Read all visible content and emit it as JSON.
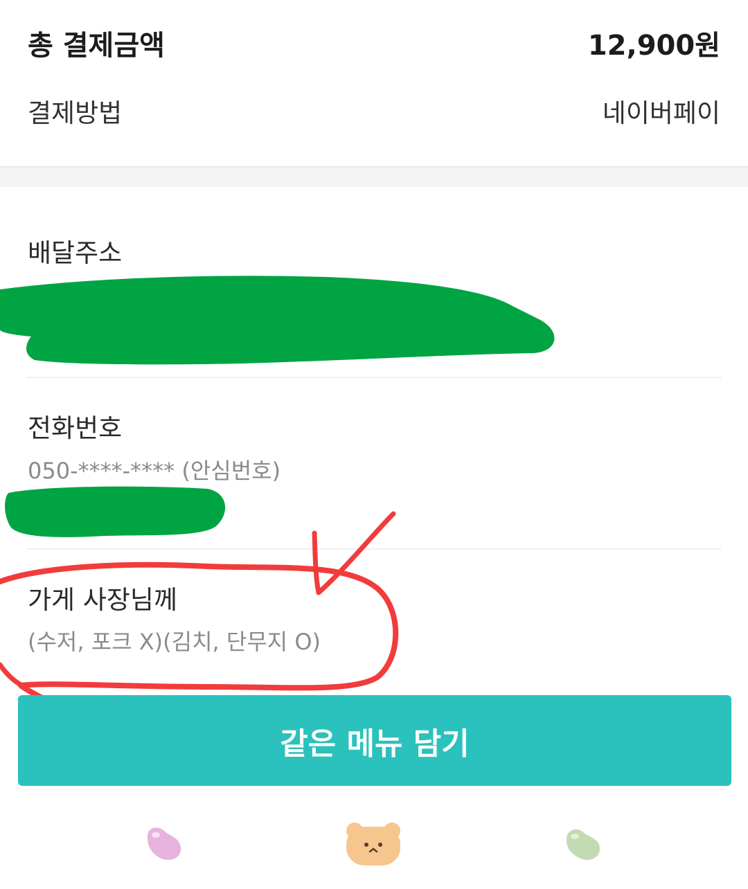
{
  "payment": {
    "total_label": "총 결제금액",
    "total_value": "12,900원",
    "method_label": "결제방법",
    "method_value": "네이버페이"
  },
  "delivery": {
    "address_label": "배달주소"
  },
  "phone": {
    "label": "전화번호",
    "value": "050-****-**** (안심번호)"
  },
  "owner_note": {
    "label": "가게 사장님께",
    "value": "(수저, 포크 X)(김치, 단무지 O)"
  },
  "actions": {
    "reorder_label": "같은 메뉴 담기"
  },
  "bottom_nav": {
    "icons": [
      "pink-bean-icon",
      "bear-face-icon",
      "green-bean-icon"
    ]
  },
  "colors": {
    "accent": "#2bc1bc",
    "redaction": "#00a443",
    "annotation": "#f23b3b"
  }
}
